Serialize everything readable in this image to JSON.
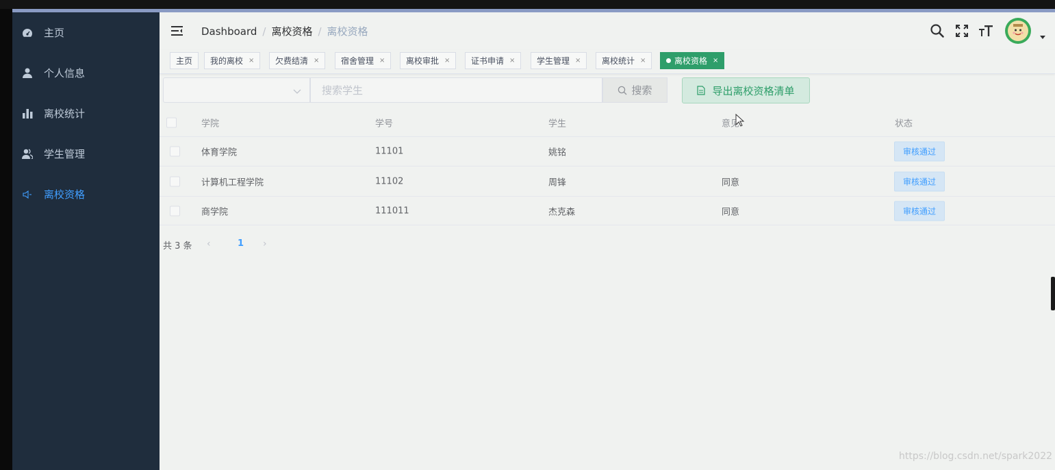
{
  "sidebar": {
    "items": [
      {
        "label": "主页",
        "icon": "dashboard-icon"
      },
      {
        "label": "个人信息",
        "icon": "user-icon"
      },
      {
        "label": "离校统计",
        "icon": "bar-chart-icon"
      },
      {
        "label": "学生管理",
        "icon": "people-icon"
      },
      {
        "label": "离校资格",
        "icon": "speaker-icon",
        "active": true
      }
    ],
    "active_color": "#409eff",
    "background": "#1f2d3d"
  },
  "navbar": {
    "breadcrumb": [
      "Dashboard",
      "离校资格",
      "离校资格"
    ],
    "icons": [
      "search-icon",
      "fullscreen-icon",
      "font-size-icon"
    ]
  },
  "tags": [
    {
      "label": "主页",
      "closable": false
    },
    {
      "label": "我的离校",
      "closable": true
    },
    {
      "label": "欠费结清",
      "closable": true
    },
    {
      "label": "宿舍管理",
      "closable": true
    },
    {
      "label": "离校审批",
      "closable": true
    },
    {
      "label": "证书申请",
      "closable": true
    },
    {
      "label": "学生管理",
      "closable": true
    },
    {
      "label": "离校统计",
      "closable": true
    },
    {
      "label": "离校资格",
      "closable": true,
      "active": true
    }
  ],
  "close_glyph": "×",
  "filter": {
    "select_value": "",
    "search_placeholder": "搜索学生",
    "search_button": "搜索",
    "export_button": "导出离校资格清单"
  },
  "table": {
    "columns": [
      "学院",
      "学号",
      "学生",
      "意见",
      "状态"
    ],
    "rows": [
      {
        "college": "体育学院",
        "id": "11101",
        "student": "姚铭",
        "opinion": "",
        "status": "审核通过"
      },
      {
        "college": "计算机工程学院",
        "id": "11102",
        "student": "周锋",
        "opinion": "同意",
        "status": "审核通过"
      },
      {
        "college": "商学院",
        "id": "111011",
        "student": "杰克森",
        "opinion": "同意",
        "status": "审核通过"
      }
    ]
  },
  "pagination": {
    "total_text": "共 3 条",
    "prev": "‹",
    "next": "›",
    "current_page": "1"
  },
  "accent_color": "#2e9e6a",
  "watermark": "https://blog.csdn.net/spark2022"
}
